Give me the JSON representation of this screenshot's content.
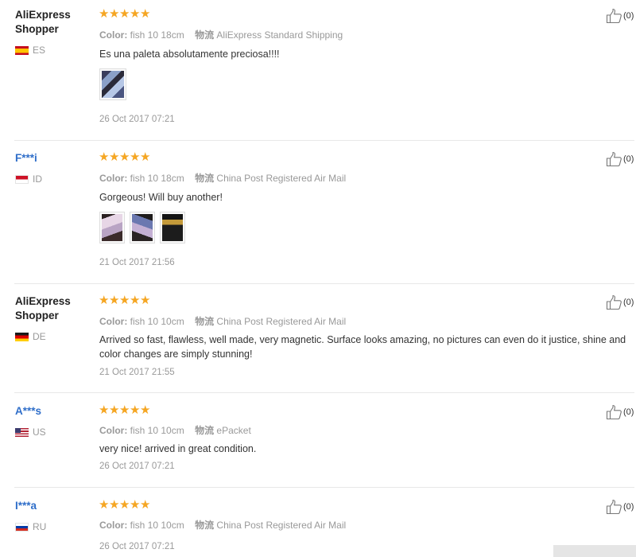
{
  "like_icon": "thumbs-up-icon",
  "colors": {
    "star": "#f5a623",
    "masked_name": "#2f6ec9",
    "meta": "#999999"
  },
  "reviews": [
    {
      "name": "AliExpress Shopper",
      "country": "ES",
      "rating": 5,
      "color_label": "Color:",
      "color_value": "fish 10 18cm",
      "shipping_label": "物流",
      "shipping_value": "AliExpress Standard Shipping",
      "text": "Es una paleta absolutamente preciosa!!!!",
      "date": "26 Oct 2017 07:21",
      "likes": "(0)"
    },
    {
      "name": "F***i",
      "country": "ID",
      "rating": 5,
      "color_label": "Color:",
      "color_value": "fish 10 18cm",
      "shipping_label": "物流",
      "shipping_value": "China Post Registered Air Mail",
      "text": "Gorgeous! Will buy another!",
      "date": "21 Oct 2017 21:56",
      "likes": "(0)"
    },
    {
      "name": "AliExpress Shopper",
      "country": "DE",
      "rating": 5,
      "color_label": "Color:",
      "color_value": "fish 10 10cm",
      "shipping_label": "物流",
      "shipping_value": "China Post Registered Air Mail",
      "text": "Arrived so fast, flawless, well made, very magnetic. Surface looks amazing, no pictures can even do it justice, shine and color changes are simply stunning!",
      "date": "21 Oct 2017 21:55",
      "likes": "(0)"
    },
    {
      "name": "A***s",
      "country": "US",
      "rating": 5,
      "color_label": "Color:",
      "color_value": "fish 10 10cm",
      "shipping_label": "物流",
      "shipping_value": "ePacket",
      "text": "very nice! arrived in great condition.",
      "date": "26 Oct 2017 07:21",
      "likes": "(0)"
    },
    {
      "name": "I***a",
      "country": "RU",
      "rating": 5,
      "color_label": "Color:",
      "color_value": "fish 10 10cm",
      "shipping_label": "物流",
      "shipping_value": "China Post Registered Air Mail",
      "text": "",
      "date": "26 Oct 2017 07:21",
      "likes": "(0)"
    }
  ]
}
